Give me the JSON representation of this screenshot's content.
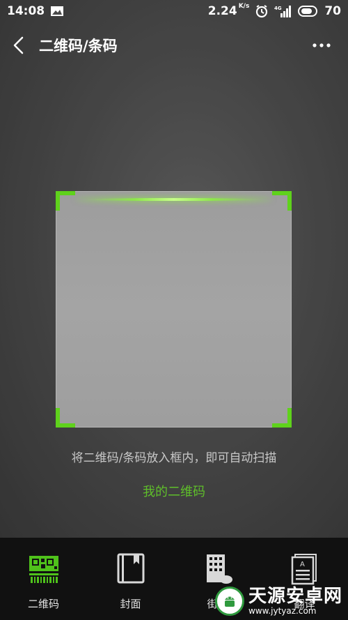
{
  "status_bar": {
    "time": "14:08",
    "net_speed": "2.24",
    "net_unit": "K/s",
    "signal_label": "4G",
    "battery": "70"
  },
  "header": {
    "title": "二维码/条码"
  },
  "scanner": {
    "hint": "将二维码/条码放入框内，即可自动扫描",
    "my_qr_label": "我的二维码"
  },
  "bottom_nav": {
    "items": [
      {
        "label": "二维码",
        "icon": "qr-code-icon"
      },
      {
        "label": "封面",
        "icon": "book-cover-icon"
      },
      {
        "label": "街景",
        "icon": "building-icon"
      },
      {
        "label": "翻译",
        "icon": "document-translate-icon"
      }
    ]
  },
  "watermark": {
    "name": "天源安卓网",
    "url": "www.jytyaz.com"
  },
  "colors": {
    "accent": "#5fd21c",
    "link": "#5fbf2a",
    "nav_bg": "#111111"
  }
}
